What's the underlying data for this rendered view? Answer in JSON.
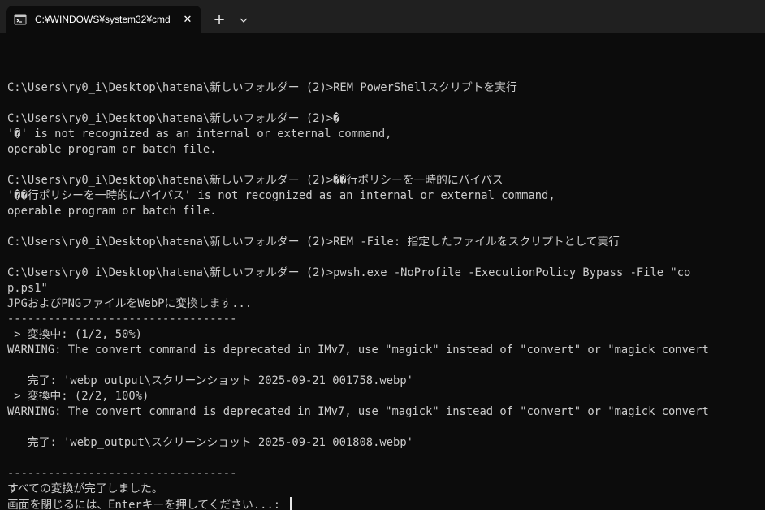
{
  "window": {
    "tab_title": "C:¥WINDOWS¥system32¥cmd",
    "tab_icon": "terminal-icon",
    "close_symbol": "✕",
    "new_tab_symbol": "+",
    "colors": {
      "background": "#0c0c0c",
      "titlebar": "#202020",
      "text": "#cccccc"
    }
  },
  "console": {
    "lines": [
      "",
      "C:\\Users\\ry0_i\\Desktop\\hatena\\新しいフォルダー (2)>REM PowerShellスクリプトを実行",
      "",
      "C:\\Users\\ry0_i\\Desktop\\hatena\\新しいフォルダー (2)>�",
      "'�' is not recognized as an internal or external command,",
      "operable program or batch file.",
      "",
      "C:\\Users\\ry0_i\\Desktop\\hatena\\新しいフォルダー (2)>��行ポリシーを一時的にバイパス",
      "'��行ポリシーを一時的にバイパス' is not recognized as an internal or external command,",
      "operable program or batch file.",
      "",
      "C:\\Users\\ry0_i\\Desktop\\hatena\\新しいフォルダー (2)>REM -File: 指定したファイルをスクリプトとして実行",
      "",
      "C:\\Users\\ry0_i\\Desktop\\hatena\\新しいフォルダー (2)>pwsh.exe -NoProfile -ExecutionPolicy Bypass -File \"co",
      "p.ps1\"",
      "JPGおよびPNGファイルをWebPに変換します...",
      "----------------------------------",
      " > 変換中: (1/2, 50%)",
      "WARNING: The convert command is deprecated in IMv7, use \"magick\" instead of \"convert\" or \"magick convert",
      "",
      "   完了: 'webp_output\\スクリーンショット 2025-09-21 001758.webp'",
      " > 変換中: (2/2, 100%)",
      "WARNING: The convert command is deprecated in IMv7, use \"magick\" instead of \"convert\" or \"magick convert",
      "",
      "   完了: 'webp_output\\スクリーンショット 2025-09-21 001808.webp'",
      "",
      "----------------------------------",
      "すべての変換が完了しました。",
      "画面を閉じるには、Enterキーを押してください...: "
    ]
  }
}
